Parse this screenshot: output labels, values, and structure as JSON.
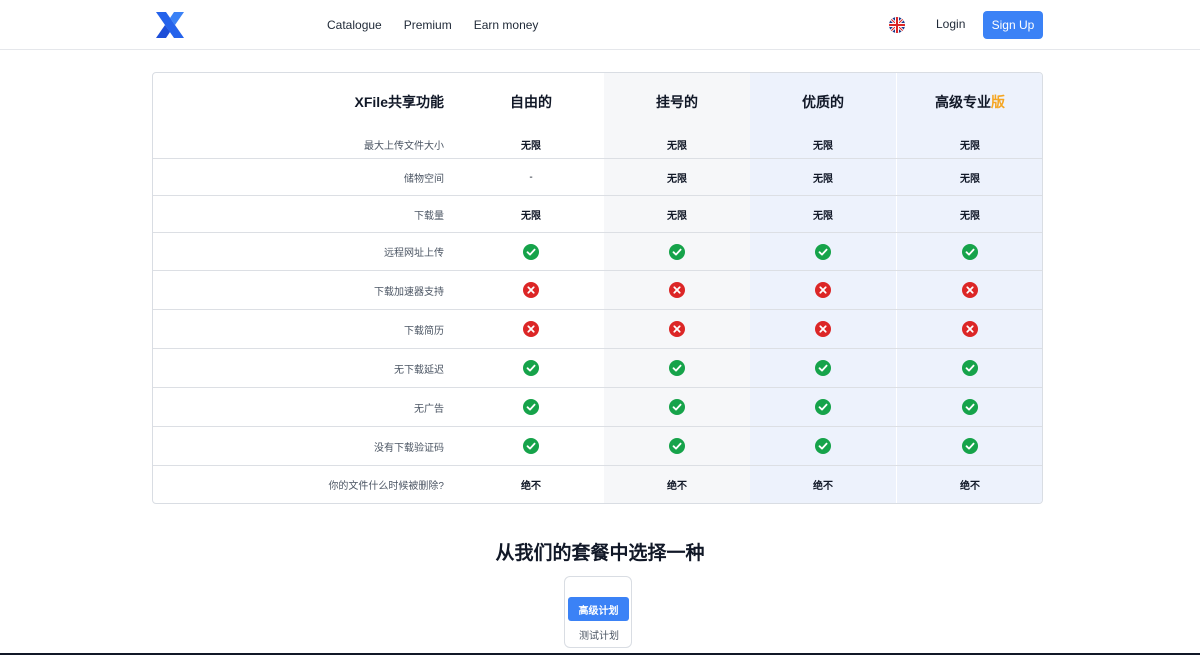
{
  "header": {
    "nav": [
      "Catalogue",
      "Premium",
      "Earn money"
    ],
    "login_label": "Login",
    "signup_label": "Sign Up",
    "accent_color": "#3b82f6"
  },
  "table": {
    "title": "XFile共享功能",
    "columns": [
      "自由的",
      "挂号的",
      "优质的",
      "高级专业"
    ],
    "pro_suffix": "版",
    "rows": [
      {
        "label": "最大上传文件大小",
        "values": [
          "无限",
          "无限",
          "无限",
          "无限"
        ]
      },
      {
        "label": "储物空间",
        "values": [
          "-",
          "无限",
          "无限",
          "无限"
        ]
      },
      {
        "label": "下载量",
        "values": [
          "无限",
          "无限",
          "无限",
          "无限"
        ]
      },
      {
        "label": "远程网址上传",
        "values": [
          "check",
          "check",
          "check",
          "check"
        ]
      },
      {
        "label": "下载加速器支持",
        "values": [
          "cross",
          "cross",
          "cross",
          "cross"
        ]
      },
      {
        "label": "下载简历",
        "values": [
          "cross",
          "cross",
          "cross",
          "cross"
        ]
      },
      {
        "label": "无下载延迟",
        "values": [
          "check",
          "check",
          "check",
          "check"
        ]
      },
      {
        "label": "无广告",
        "values": [
          "check",
          "check",
          "check",
          "check"
        ]
      },
      {
        "label": "没有下载验证码",
        "values": [
          "check",
          "check",
          "check",
          "check"
        ]
      },
      {
        "label": "你的文件什么时候被删除?",
        "values": [
          "绝不",
          "绝不",
          "绝不",
          "绝不"
        ]
      }
    ],
    "check_color": "#16a34a",
    "cross_color": "#dc2626"
  },
  "plans": {
    "title": "从我们的套餐中选择一种",
    "active_label": "高级计划",
    "test_label": "测试计划"
  }
}
